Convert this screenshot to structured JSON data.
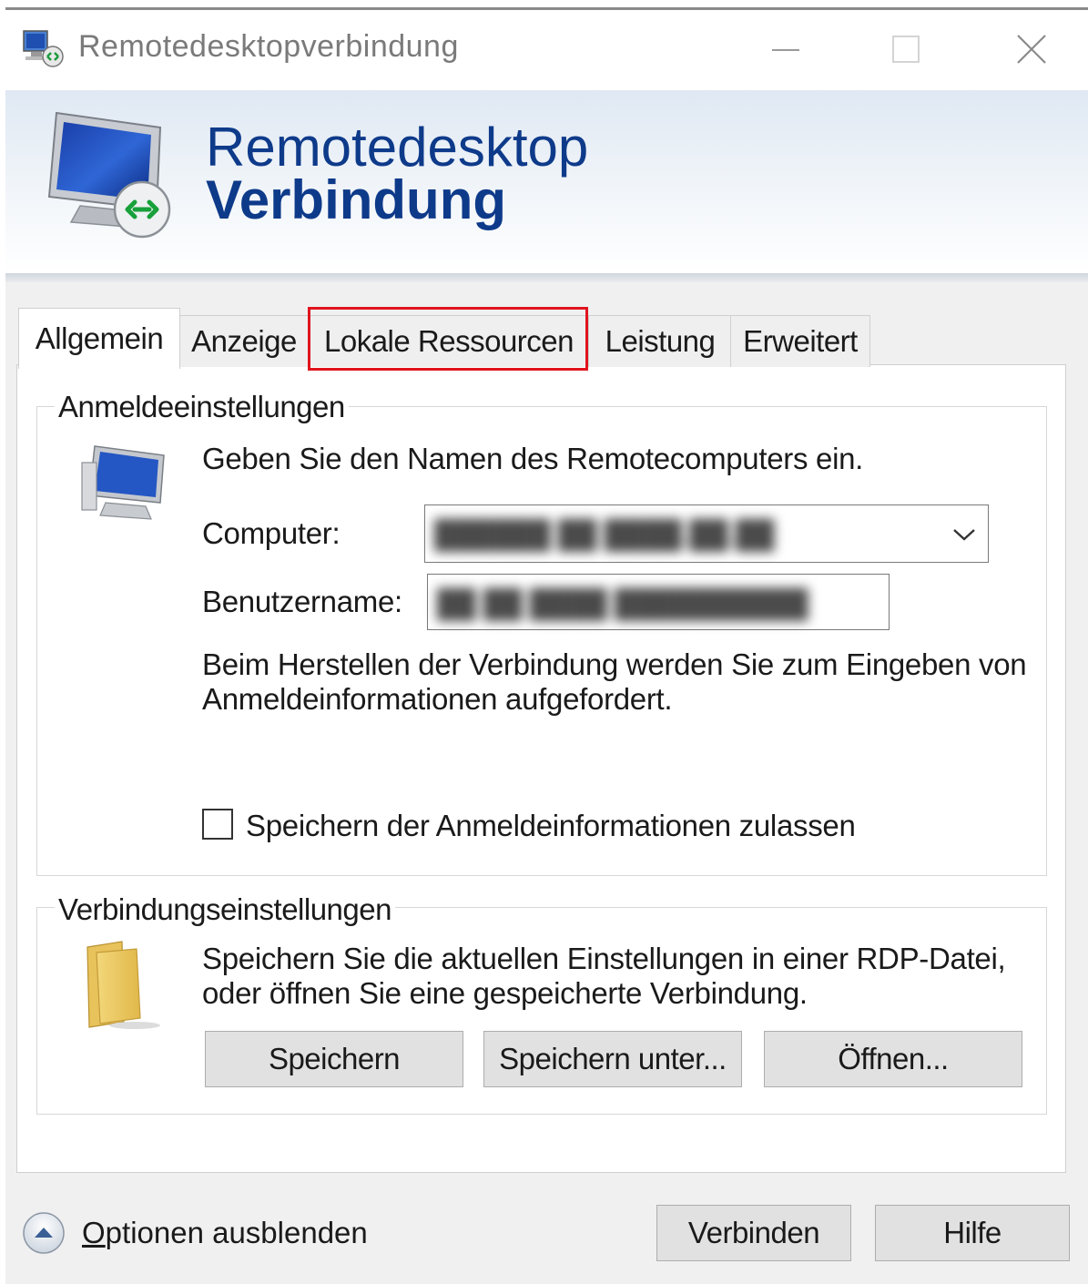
{
  "window": {
    "title": "Remotedesktopverbindung",
    "controls": [
      "minimize",
      "maximize",
      "close"
    ]
  },
  "banner": {
    "line1": "Remotedesktop",
    "line2": "Verbindung"
  },
  "tabs": [
    {
      "label": "Allgemein",
      "active": true
    },
    {
      "label": "Anzeige",
      "active": false
    },
    {
      "label": "Lokale Ressourcen",
      "active": false,
      "highlighted": true
    },
    {
      "label": "Leistung",
      "active": false
    },
    {
      "label": "Erweitert",
      "active": false
    }
  ],
  "login_settings": {
    "legend": "Anmeldeeinstellungen",
    "instruction": "Geben Sie den Namen des Remotecomputers ein.",
    "computer_label": "Computer:",
    "computer_value": "██████ ██ ████.██.██",
    "username_label": "Benutzername:",
    "username_value": "██ ██ ████ ██████████",
    "info_line1": "Beim Herstellen der Verbindung werden Sie zum Eingeben von",
    "info_line2": "Anmeldeinformationen aufgefordert.",
    "save_credentials_label": "Speichern der Anmeldeinformationen zulassen",
    "save_credentials_checked": false
  },
  "connection_settings": {
    "legend": "Verbindungseinstellungen",
    "text_line1": "Speichern Sie die aktuellen Einstellungen in einer RDP-Datei,",
    "text_line2": "oder öffnen Sie eine gespeicherte Verbindung.",
    "save_button": "Speichern",
    "save_as_button": "Speichern unter...",
    "open_button": "Öffnen..."
  },
  "footer": {
    "options_label_underlined": "O",
    "options_label_rest": "ptionen ausblenden",
    "connect_button": "Verbinden",
    "help_button": "Hilfe"
  },
  "colors": {
    "banner_text": "#0e3a8a",
    "highlight": "#e0141e",
    "window_bg": "#f0f0f0"
  }
}
